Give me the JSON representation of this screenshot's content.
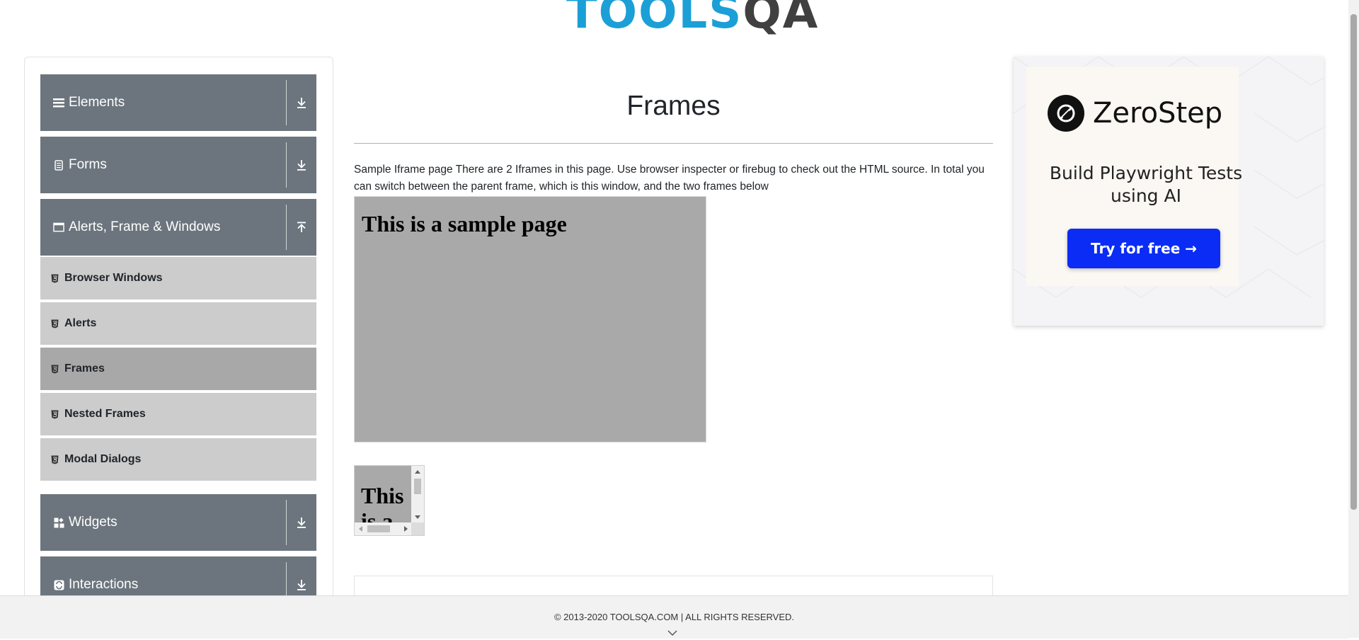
{
  "header": {
    "logo_main": "TOOLS",
    "logo_accent": "QA"
  },
  "sidebar": {
    "groups": [
      {
        "label": "Elements",
        "icon": "hamburger-icon",
        "state": "collapsed"
      },
      {
        "label": "Forms",
        "icon": "document-icon",
        "state": "collapsed"
      },
      {
        "label": "Alerts, Frame & Windows",
        "icon": "window-icon",
        "state": "expanded"
      },
      {
        "label": "Widgets",
        "icon": "widgets-icon",
        "state": "collapsed"
      },
      {
        "label": "Interactions",
        "icon": "interactions-icon",
        "state": "collapsed"
      }
    ],
    "subitems": [
      {
        "label": "Browser Windows",
        "active": false
      },
      {
        "label": "Alerts",
        "active": false
      },
      {
        "label": "Frames",
        "active": true
      },
      {
        "label": "Nested Frames",
        "active": false
      },
      {
        "label": "Modal Dialogs",
        "active": false
      }
    ]
  },
  "main": {
    "title": "Frames",
    "description": "Sample Iframe page There are 2 Iframes in this page. Use browser inspecter or firebug to check out the HTML source. In total you can switch between the parent frame, which is this window, and the two frames below",
    "frame1_text": "This is a sample page",
    "frame2_text": "This is a sample page"
  },
  "ad": {
    "brand": "ZeroStep",
    "headline": "Build Playwright Tests using AI",
    "cta": "Try for free →"
  },
  "footer": {
    "text": "© 2013-2020 TOOLSQA.COM | ALL RIGHTS RESERVED."
  },
  "colors": {
    "group_bg": "#6c757d",
    "subitem_bg": "#cccccc",
    "subitem_active_bg": "#a8a8a8",
    "frame_bg": "#a9a9a9",
    "cta_bg": "#0a2cf5",
    "logo_blue": "#1b9fd6"
  }
}
